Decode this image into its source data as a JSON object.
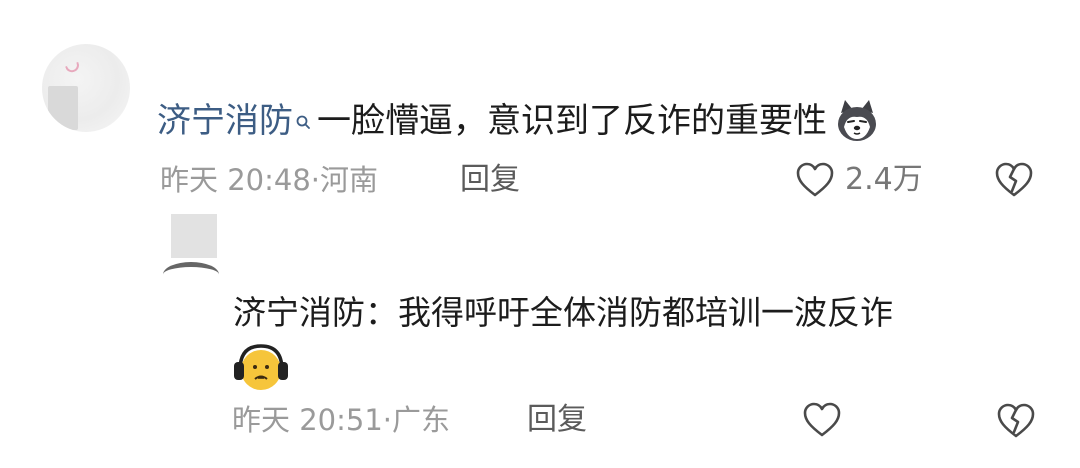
{
  "comment": {
    "author": "济宁消防",
    "text": "一脸懵逼，意识到了反诈的重要性",
    "emoji": "dog-face-emoji",
    "time": "昨天 20:48",
    "location": "河南",
    "reply_label": "回复",
    "like_count": "2.4万"
  },
  "reply": {
    "text": "济宁消防：我得呼吁全体消防都培训一波反诈",
    "emoji": "headphones-face-emoji",
    "time": "昨天 20:51",
    "location": "广东",
    "reply_label": "回复"
  },
  "icons": {
    "author_badge": "search-badge-icon",
    "like": "heart-outline-icon",
    "dislike": "broken-heart-icon"
  },
  "colors": {
    "author": "#3d5d84",
    "text": "#1c1c1c",
    "meta": "#9a9a9a",
    "action": "#5b5b5b"
  }
}
